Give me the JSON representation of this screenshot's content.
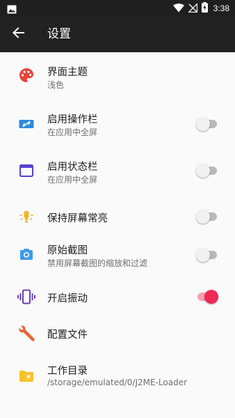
{
  "status_bar": {
    "time": "3:38",
    "icons": [
      "image-icon",
      "wifi-icon",
      "signal-off-icon",
      "battery-charging-icon"
    ]
  },
  "app_bar": {
    "back_icon": "arrow-back-icon",
    "title": "设置"
  },
  "colors": {
    "palette": "#e8433c",
    "action_bar": "#2d89e0",
    "status_bar": "#5a3fd4",
    "bulb": "#f5b32a",
    "camera": "#3d9be8",
    "vibrate": "#6a3fb8",
    "wrench": "#e5673a",
    "folder": "#f6c22c",
    "switch_on": "#ee2a55"
  },
  "settings": {
    "theme": {
      "icon": "palette-icon",
      "title": "界面主题",
      "subtitle": "浅色"
    },
    "action_bar": {
      "icon": "action-bar-icon",
      "title": "启用操作栏",
      "subtitle": "在应用中全屏",
      "enabled": false
    },
    "status_bar": {
      "icon": "window-icon",
      "title": "启用状态栏",
      "subtitle": "在应用中全屏",
      "enabled": false
    },
    "keep_screen_on": {
      "icon": "lightbulb-icon",
      "title": "保持屏幕常亮",
      "enabled": false
    },
    "original_screenshot": {
      "icon": "camera-icon",
      "title": "原始截图",
      "subtitle": "禁用屏幕截图的缩放和过滤",
      "enabled": false
    },
    "vibration": {
      "icon": "vibration-icon",
      "title": "开启振动",
      "enabled": true
    },
    "config_file": {
      "icon": "wrench-icon",
      "title": "配置文件"
    },
    "working_dir": {
      "icon": "star-folder-icon",
      "title": "工作目录",
      "subtitle": "/storage/emulated/0/J2ME-Loader"
    }
  }
}
